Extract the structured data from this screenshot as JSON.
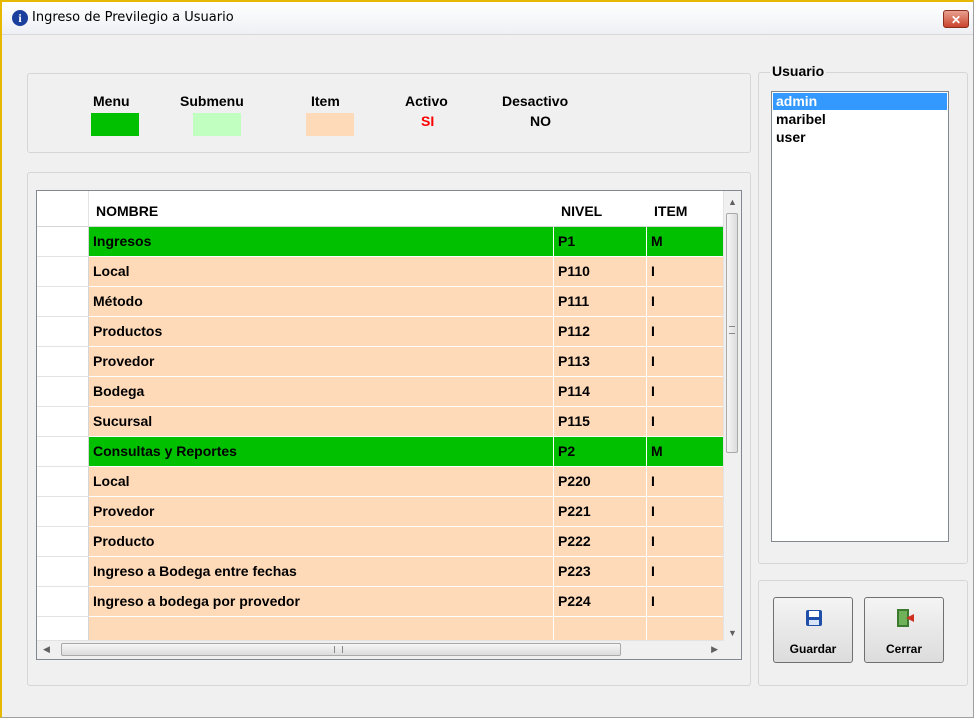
{
  "window": {
    "title": "Ingreso de Previlegio a Usuario"
  },
  "legend": {
    "menu_label": "Menu",
    "submenu_label": "Submenu",
    "item_label": "Item",
    "activo_label": "Activo",
    "activo_value": "SI",
    "desactivo_label": "Desactivo",
    "desactivo_value": "NO",
    "colors": {
      "menu": "#00c000",
      "submenu": "#c0ffc0",
      "item": "#ffdab9",
      "activo_value": "#ff0000"
    }
  },
  "grid": {
    "columns": [
      "NOMBRE",
      "NIVEL",
      "ITEM"
    ],
    "rows": [
      {
        "nombre": "Ingresos",
        "nivel": "P1",
        "item": "M"
      },
      {
        "nombre": "Local",
        "nivel": "P110",
        "item": "I"
      },
      {
        "nombre": "Método",
        "nivel": "P111",
        "item": "I"
      },
      {
        "nombre": "Productos",
        "nivel": "P112",
        "item": "I"
      },
      {
        "nombre": "Provedor",
        "nivel": "P113",
        "item": "I"
      },
      {
        "nombre": "Bodega",
        "nivel": "P114",
        "item": "I"
      },
      {
        "nombre": "Sucursal",
        "nivel": "P115",
        "item": "I"
      },
      {
        "nombre": "Consultas y Reportes",
        "nivel": "P2",
        "item": "M"
      },
      {
        "nombre": "Local",
        "nivel": "P220",
        "item": "I"
      },
      {
        "nombre": "Provedor",
        "nivel": "P221",
        "item": "I"
      },
      {
        "nombre": "Producto",
        "nivel": "P222",
        "item": "I"
      },
      {
        "nombre": "Ingreso a Bodega entre fechas",
        "nivel": "P223",
        "item": "I"
      },
      {
        "nombre": "Ingreso a bodega por provedor",
        "nivel": "P224",
        "item": "I"
      },
      {
        "nombre": "",
        "nivel": "",
        "item": ""
      }
    ]
  },
  "usuario": {
    "label": "Usuario",
    "users": [
      "admin",
      "maribel",
      "user"
    ],
    "selected": "admin"
  },
  "buttons": {
    "guardar": "Guardar",
    "cerrar": "Cerrar"
  },
  "icons": {
    "title": "info-icon",
    "close": "close-icon",
    "guardar": "floppy-disk-icon",
    "cerrar": "exit-door-icon"
  }
}
